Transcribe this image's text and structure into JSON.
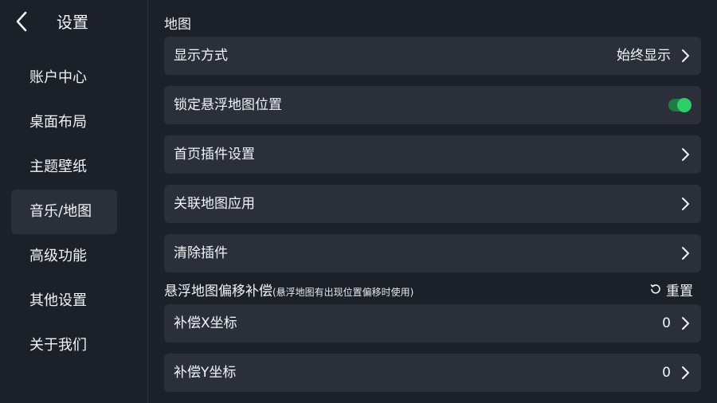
{
  "sidebar": {
    "title": "设置",
    "items": [
      {
        "label": "账户中心"
      },
      {
        "label": "桌面布局"
      },
      {
        "label": "主题壁纸"
      },
      {
        "label": "音乐/地图"
      },
      {
        "label": "高级功能"
      },
      {
        "label": "其他设置"
      },
      {
        "label": "关于我们"
      }
    ],
    "active_index": 3
  },
  "main": {
    "section_map": "地图",
    "display_mode": {
      "label": "显示方式",
      "value": "始终显示"
    },
    "lock_map": {
      "label": "锁定悬浮地图位置",
      "toggle_on": true
    },
    "home_plugin": {
      "label": "首页插件设置"
    },
    "linked_map_app": {
      "label": "关联地图应用"
    },
    "clear_plugin": {
      "label": "清除插件"
    },
    "offset_section": {
      "title": "悬浮地图偏移补偿",
      "note": "(悬浮地图有出现位置偏移时使用)",
      "reset_label": "重置"
    },
    "offset_x": {
      "label": "补偿X坐标",
      "value": "0"
    },
    "offset_y": {
      "label": "补偿Y坐标",
      "value": "0"
    }
  },
  "colors": {
    "background": "#1c2029",
    "card": "#2a2f3a",
    "toggle_on": "#2fcd6a"
  },
  "icons": [
    "back-arrow-icon",
    "chevron-right-icon",
    "reset-icon",
    "toggle-switch"
  ]
}
